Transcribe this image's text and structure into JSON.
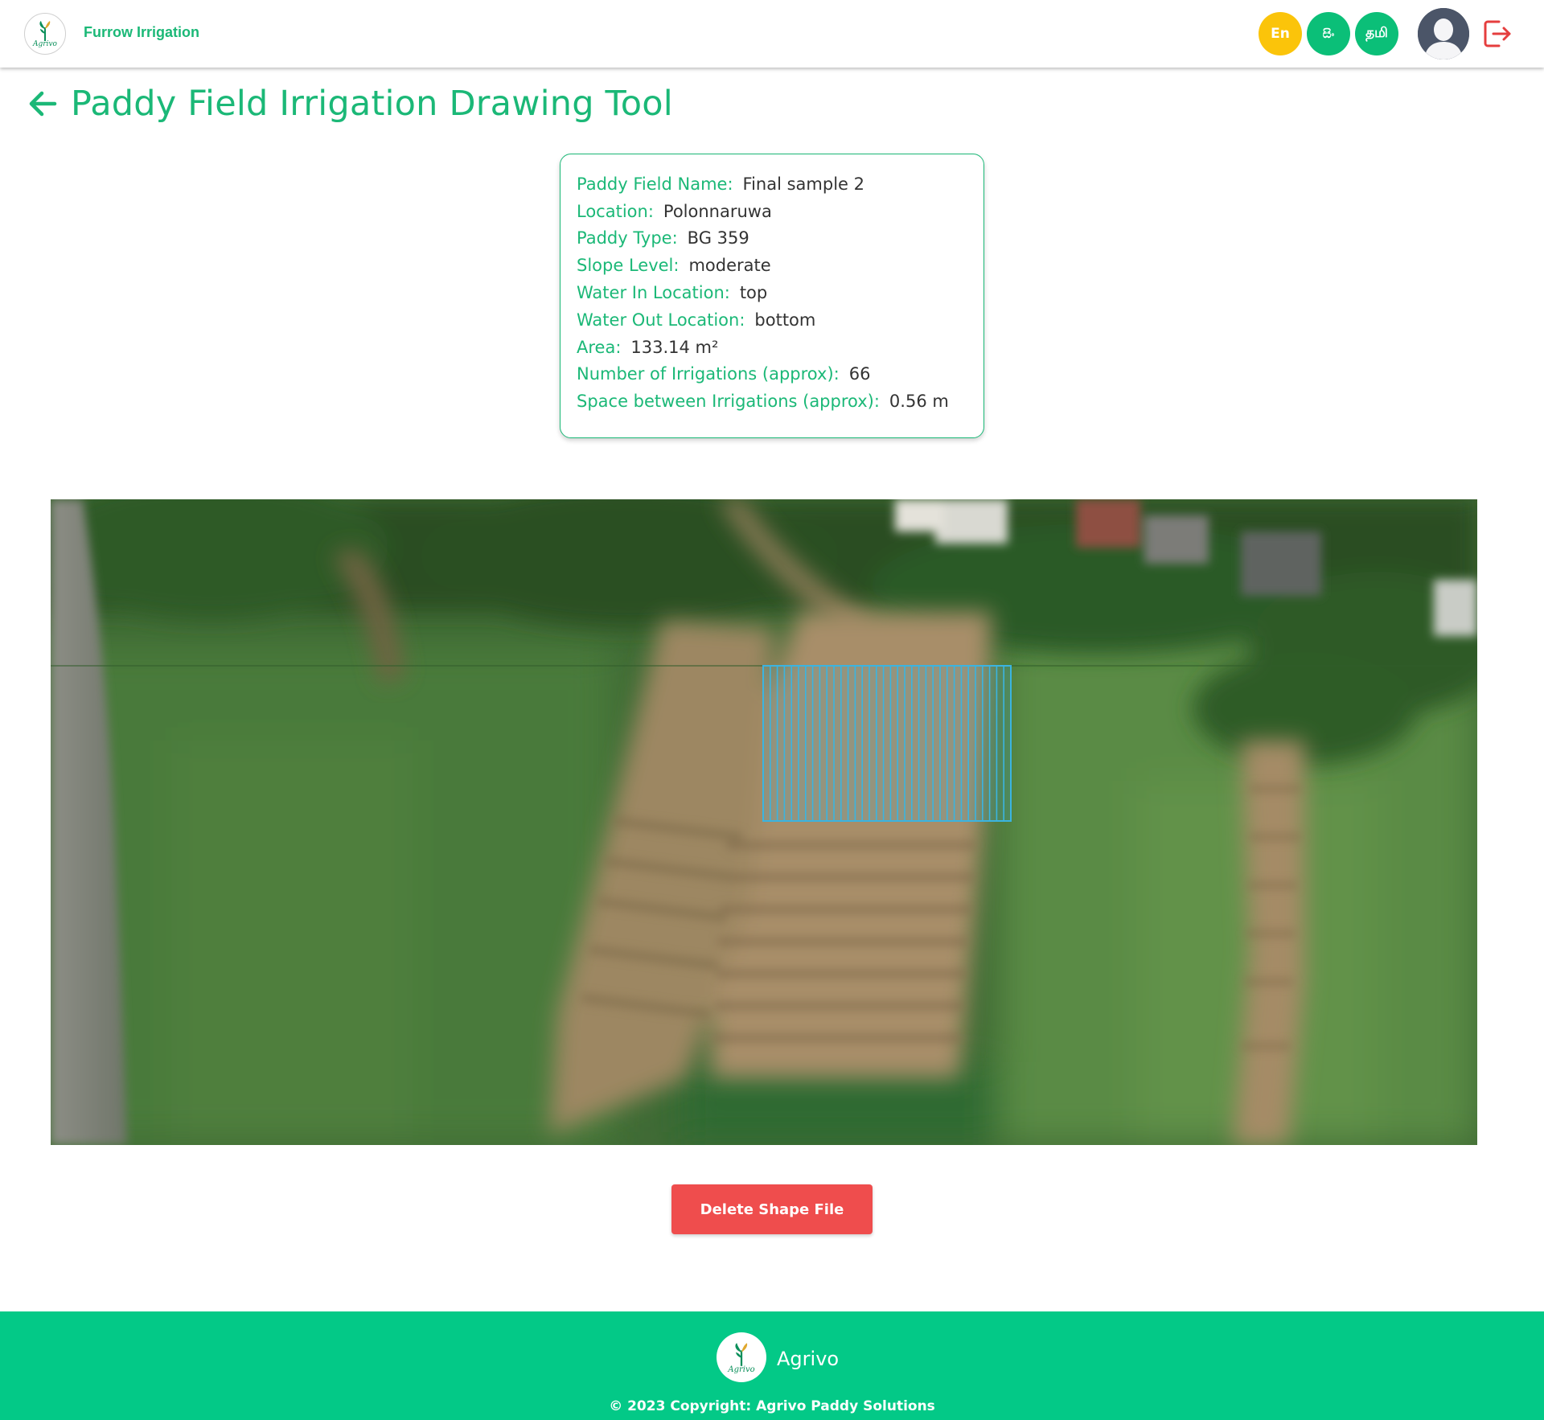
{
  "header": {
    "logo_text": "Agrivo",
    "brand_link": "Furrow Irrigation",
    "languages": [
      {
        "code": "en",
        "label": "En"
      },
      {
        "code": "si",
        "label": "සිං"
      },
      {
        "code": "ta",
        "label": "தமி"
      }
    ],
    "icons": {
      "avatar": "user-avatar-icon",
      "logout": "logout-icon"
    },
    "colors": {
      "accent": "#1bb877",
      "lang_en": "#fbc40a",
      "lang_other": "#0bbf78",
      "logout": "#e53e3e"
    }
  },
  "page": {
    "title": "Paddy Field Irrigation Drawing Tool",
    "back_icon": "arrow-left-icon"
  },
  "field_info": [
    {
      "label": "Paddy Field Name:",
      "value": "Final sample 2"
    },
    {
      "label": "Location:",
      "value": "Polonnaruwa"
    },
    {
      "label": "Paddy Type:",
      "value": "BG 359"
    },
    {
      "label": "Slope Level:",
      "value": "moderate"
    },
    {
      "label": "Water In Location:",
      "value": "top"
    },
    {
      "label": "Water Out Location:",
      "value": "bottom"
    },
    {
      "label": "Area:",
      "value": "133.14 m²"
    },
    {
      "label": "Number of Irrigations (approx):",
      "value": "66"
    },
    {
      "label": "Space between Irrigations (approx):",
      "value": "0.56 m"
    }
  ],
  "map": {
    "type": "satellite-imagery",
    "overlay": {
      "shape": "rectangle",
      "line_pattern": "vertical-furrow-lines",
      "color": "#3bb4e0"
    }
  },
  "actions": {
    "delete_label": "Delete Shape File",
    "delete_color": "#ef4d4d"
  },
  "footer": {
    "brand": "Agrivo",
    "copyright": "© 2023 Copyright: Agrivo Paddy Solutions",
    "background": "#03c987"
  }
}
